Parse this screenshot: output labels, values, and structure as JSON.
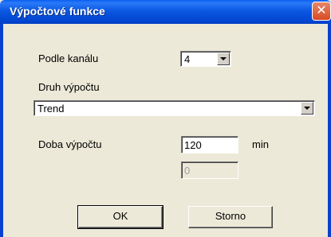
{
  "window": {
    "title": "Výpočtové funkce",
    "close_glyph": "✕"
  },
  "channel": {
    "label": "Podle kanálu",
    "value": "4"
  },
  "calc_type": {
    "label": "Druh výpočtu",
    "value": "Trend"
  },
  "duration": {
    "label": "Doba výpočtu",
    "value": "120",
    "unit": "min",
    "secondary_value": "0"
  },
  "buttons": {
    "ok": "OK",
    "cancel": "Storno"
  }
}
